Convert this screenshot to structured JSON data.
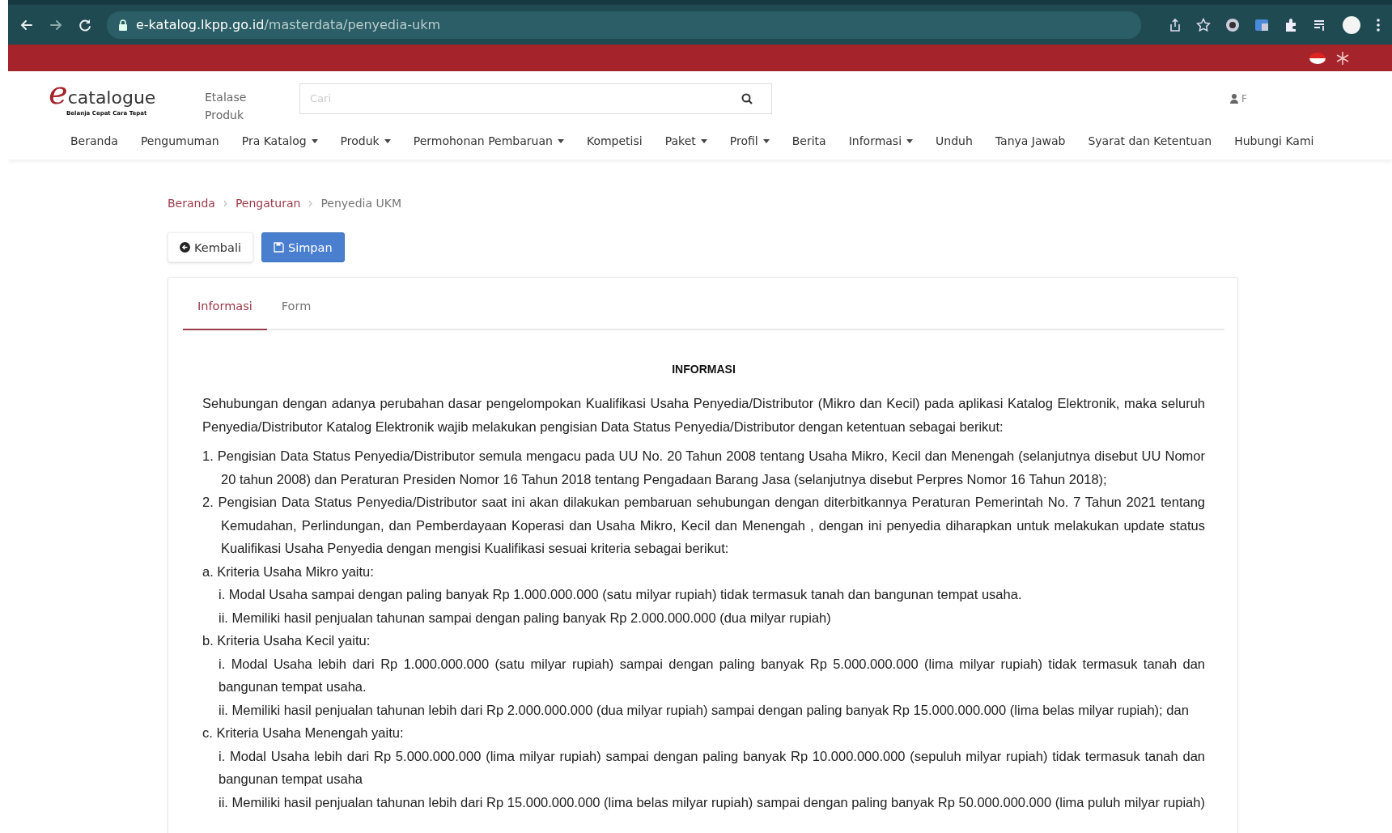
{
  "browser": {
    "url_host": "e-katalog.lkpp.go.id",
    "url_path": "/masterdata/penyedia-ukm"
  },
  "header": {
    "logo_letter": "e",
    "logo_text": "catalogue",
    "logo_tagline": "Belanja Cepat Cara Tepat",
    "etalase": "Etalase Produk",
    "search": {
      "placeholder": "Cari"
    },
    "user": "F"
  },
  "nav": [
    {
      "label": "Beranda",
      "dropdown": false
    },
    {
      "label": "Pengumuman",
      "dropdown": false
    },
    {
      "label": "Pra Katalog",
      "dropdown": true
    },
    {
      "label": "Produk",
      "dropdown": true
    },
    {
      "label": "Permohonan Pembaruan",
      "dropdown": true
    },
    {
      "label": "Kompetisi",
      "dropdown": false
    },
    {
      "label": "Paket",
      "dropdown": true
    },
    {
      "label": "Profil",
      "dropdown": true
    },
    {
      "label": "Berita",
      "dropdown": false
    },
    {
      "label": "Informasi",
      "dropdown": true
    },
    {
      "label": "Unduh",
      "dropdown": false
    },
    {
      "label": "Tanya Jawab",
      "dropdown": false
    },
    {
      "label": "Syarat dan Ketentuan",
      "dropdown": false
    },
    {
      "label": "Hubungi Kami",
      "dropdown": false
    }
  ],
  "breadcrumb": [
    {
      "label": "Beranda",
      "link": true
    },
    {
      "label": "Pengaturan",
      "link": true
    },
    {
      "label": "Penyedia UKM",
      "link": false
    }
  ],
  "buttons": [
    {
      "label": "Kembali",
      "kind": "back"
    },
    {
      "label": "Simpan",
      "kind": "save"
    }
  ],
  "tabs": [
    {
      "label": "Informasi",
      "selected": true
    },
    {
      "label": "Form",
      "selected": false
    }
  ],
  "content": {
    "heading": "INFORMASI",
    "intro": "Sehubungan dengan adanya perubahan dasar pengelompokan Kualifikasi Usaha Penyedia/Distributor (Mikro dan Kecil) pada aplikasi Katalog Elektronik, maka seluruh Penyedia/Distributor Katalog Elektronik wajib melakukan pengisian Data Status Penyedia/Distributor dengan ketentuan sebagai berikut:",
    "items": [
      {
        "marker": "1.",
        "text": "Pengisian Data Status Penyedia/Distributor semula mengacu pada UU No. 20 Tahun 2008 tentang Usaha Mikro, Kecil dan Menengah (selanjutnya disebut UU Nomor 20 tahun 2008) dan Peraturan Presiden Nomor 16 Tahun 2018 tentang Pengadaan Barang Jasa (selanjutnya disebut Perpres Nomor 16 Tahun 2018);"
      },
      {
        "marker": "2.",
        "text": "Pengisian Data Status Penyedia/Distributor saat ini akan dilakukan pembaruan sehubungan dengan diterbitkannya Peraturan Pemerintah No. 7 Tahun 2021 tentang Kemudahan, Perlindungan, dan Pemberdayaan Koperasi dan Usaha Mikro, Kecil dan Menengah , dengan ini penyedia diharapkan untuk melakukan update status Kualifikasi Usaha Penyedia dengan mengisi Kualifikasi sesuai kriteria sebagai berikut:",
        "children": [
          {
            "marker": "a.",
            "text": "Kriteria Usaha Mikro yaitu:",
            "children": [
              {
                "marker": "i.",
                "text": "Modal Usaha sampai dengan paling banyak Rp 1.000.000.000 (satu milyar rupiah) tidak termasuk tanah dan bangunan tempat usaha."
              },
              {
                "marker": "ii.",
                "text": "Memiliki hasil penjualan tahunan sampai dengan paling banyak Rp 2.000.000.000 (dua milyar rupiah)"
              }
            ]
          },
          {
            "marker": "b.",
            "text": "Kriteria Usaha Kecil yaitu:",
            "children": [
              {
                "marker": "i.",
                "text": "Modal Usaha lebih dari Rp 1.000.000.000 (satu milyar rupiah) sampai dengan paling banyak Rp 5.000.000.000 (lima milyar rupiah) tidak termasuk tanah dan bangunan tempat usaha."
              },
              {
                "marker": "ii.",
                "text": "Memiliki hasil penjualan tahunan lebih dari Rp 2.000.000.000 (dua milyar rupiah) sampai dengan paling banyak Rp 15.000.000.000 (lima belas milyar rupiah); dan"
              }
            ]
          },
          {
            "marker": "c.",
            "text": "Kriteria Usaha Menengah yaitu:",
            "children": [
              {
                "marker": "i.",
                "text": "Modal Usaha lebih dari Rp 5.000.000.000 (lima milyar rupiah) sampai dengan paling banyak Rp 10.000.000.000 (sepuluh milyar rupiah) tidak termasuk tanah dan bangunan tempat usaha"
              },
              {
                "marker": "ii.",
                "text": "Memiliki hasil penjualan tahunan lebih dari Rp 15.000.000.000 (lima belas milyar rupiah) sampai dengan paling banyak Rp 50.000.000.000 (lima puluh milyar rupiah)"
              }
            ]
          }
        ]
      }
    ]
  }
}
